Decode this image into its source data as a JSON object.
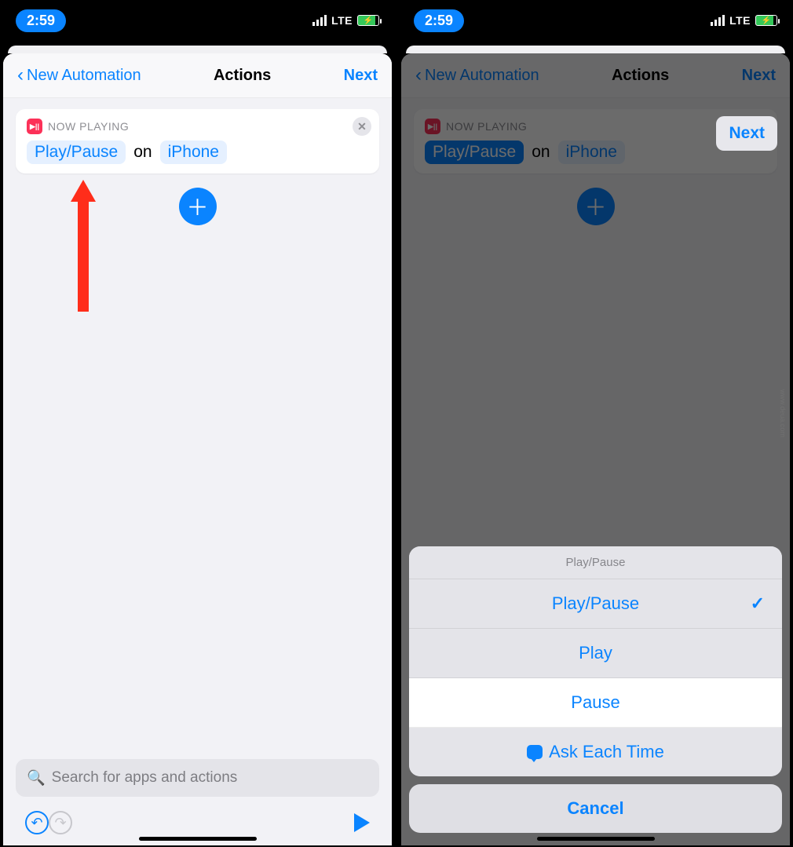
{
  "statusbar": {
    "time": "2:59",
    "network": "LTE"
  },
  "left": {
    "nav": {
      "back": "New Automation",
      "title": "Actions",
      "next": "Next"
    },
    "card": {
      "label": "NOW PLAYING",
      "action": "Play/Pause",
      "word_on": "on",
      "device": "iPhone"
    },
    "search_placeholder": "Search for apps and actions"
  },
  "right": {
    "nav": {
      "back": "New Automation",
      "title": "Actions",
      "next": "Next"
    },
    "card": {
      "label": "NOW PLAYING",
      "action": "Play/Pause",
      "word_on": "on",
      "device": "iPhone"
    },
    "sheet": {
      "header": "Play/Pause",
      "items": [
        "Play/Pause",
        "Play",
        "Pause",
        "Ask Each Time"
      ],
      "cancel": "Cancel"
    }
  },
  "watermark": "www.deua.com"
}
